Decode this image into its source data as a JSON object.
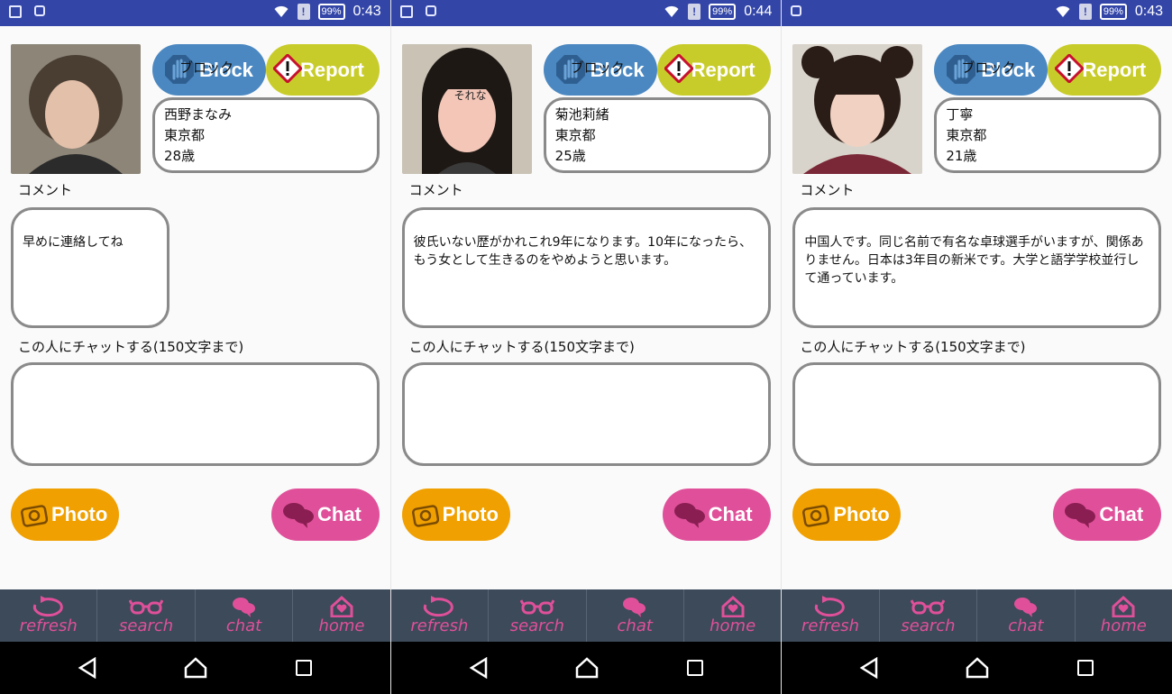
{
  "status_bar": {
    "battery": "99%"
  },
  "labels": {
    "comment": "コメント",
    "chat_to": "この人にチャットする(150文字まで)",
    "block_en": "Block",
    "block_jp": "ブロック",
    "report": "Report",
    "photo": "Photo",
    "chat": "Chat"
  },
  "nav": [
    "refresh",
    "search",
    "chat",
    "home"
  ],
  "colors": {
    "status_bar": "#3346a8",
    "block": "#4b88c1",
    "report": "#c8cc2a",
    "photo": "#f0a000",
    "chat": "#e0509a",
    "nav_bg": "#3c4a5a",
    "nav_text": "#e0509a"
  },
  "screens": [
    {
      "time": "0:43",
      "name": "西野まなみ",
      "area": "東京都",
      "age": "28歳",
      "comment": "早めに連絡してね",
      "photo_text": "",
      "photo_colors": {
        "bg": "#8c8578",
        "hair": "#4a3e33",
        "face": "#e3c0aa",
        "cloth": "#2b2b2b"
      }
    },
    {
      "time": "0:44",
      "name": "菊池莉緒",
      "area": "東京都",
      "age": "25歳",
      "comment": "彼氏いない歴がかれこれ9年になります。10年になったら、もう女として生きるのをやめようと思います。",
      "photo_text": "それな",
      "photo_colors": {
        "bg": "#c9c2b5",
        "hair": "#1e1814",
        "face": "#f3c6b8",
        "cloth": "#3a3a3a"
      }
    },
    {
      "time": "0:43",
      "name": "丁寧",
      "area": "東京都",
      "age": "21歳",
      "comment": "中国人です。同じ名前で有名な卓球選手がいますが、関係ありません。日本は3年目の新米です。大学と語学学校並行して通っています。",
      "photo_text": "",
      "photo_colors": {
        "bg": "#d9d4cb",
        "hair": "#2a1c16",
        "face": "#f1d2c2",
        "cloth": "#7a2838"
      }
    }
  ]
}
